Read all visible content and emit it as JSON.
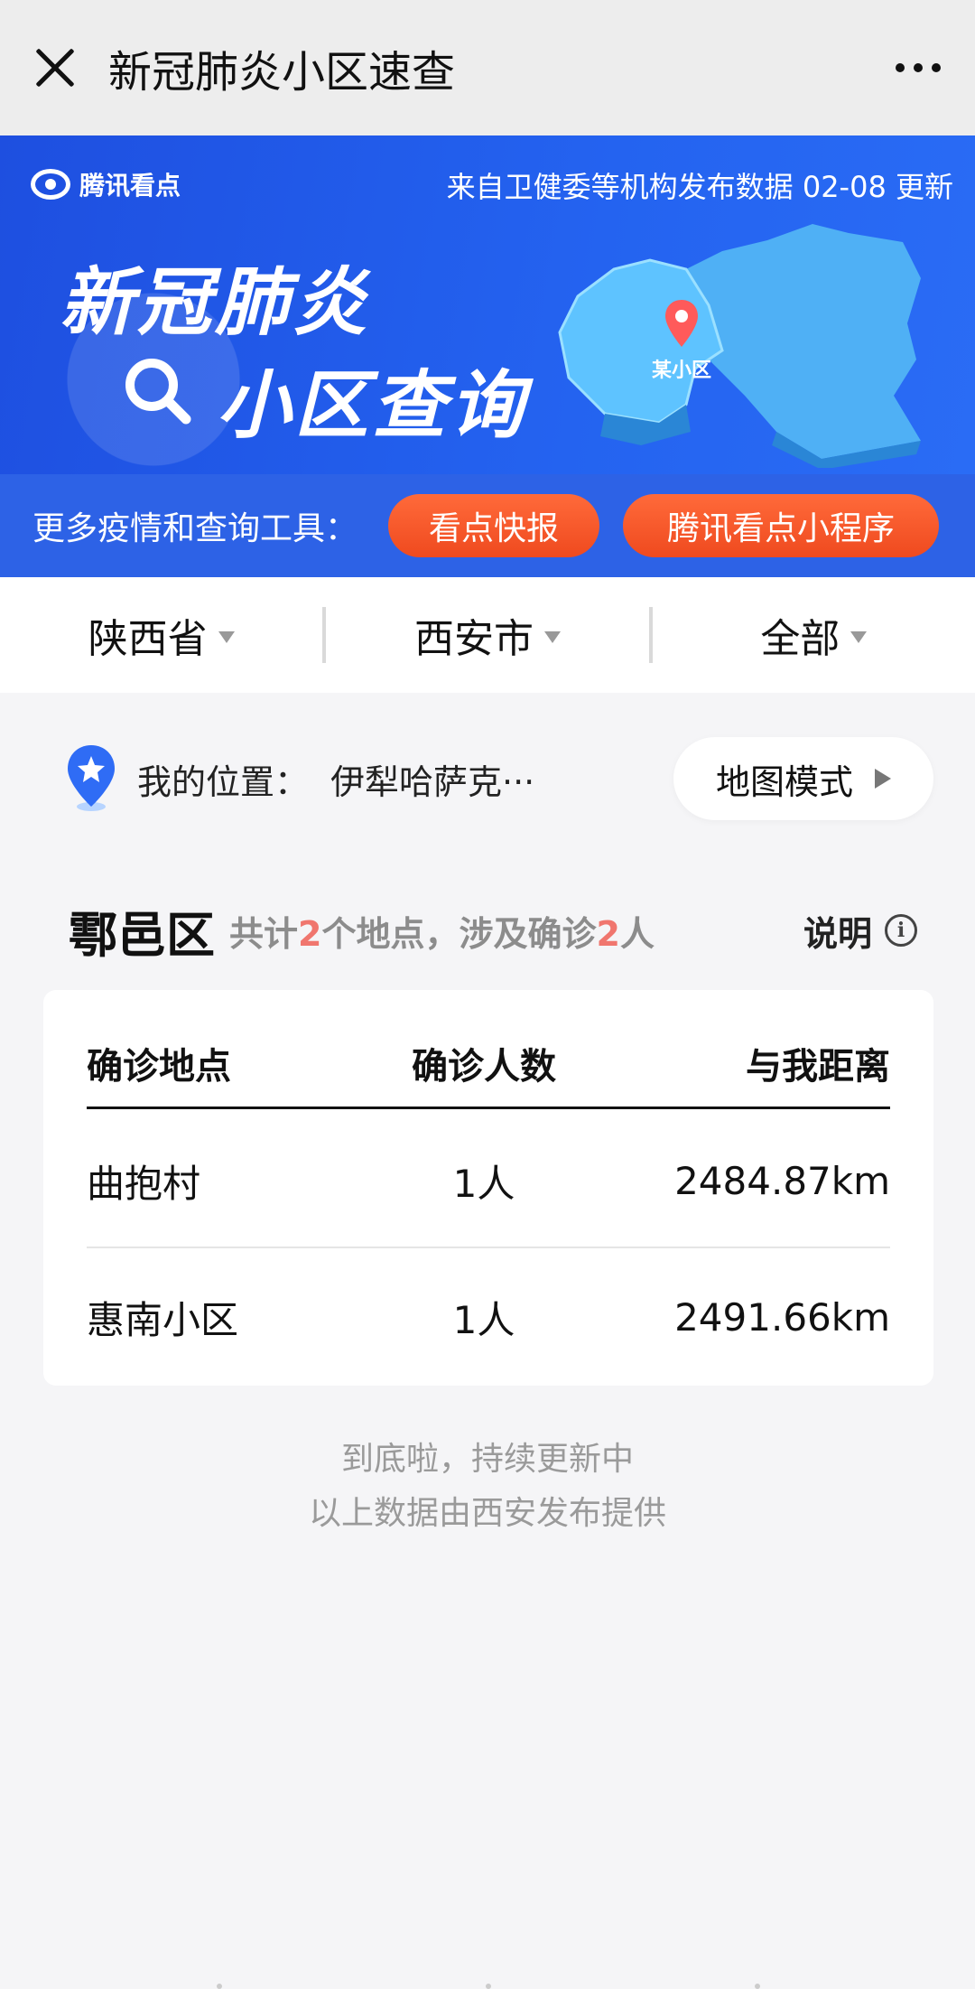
{
  "titlebar": {
    "title": "新冠肺炎小区速查"
  },
  "banner": {
    "brand": "腾讯看点",
    "update": "来自卫健委等机构发布数据  02-08 更新",
    "title_line1": "新冠肺炎",
    "title_line2": "小区查询",
    "map_label": "某小区"
  },
  "tools": {
    "label": "更多疫情和查询工具：",
    "buttons": {
      "news": "看点快报",
      "mini_program": "腾讯看点小程序"
    }
  },
  "filters": {
    "province": "陕西省",
    "city": "西安市",
    "district": "全部"
  },
  "location": {
    "label": "我的位置：",
    "value": "伊犁哈萨克···",
    "map_mode": "地图模式"
  },
  "district": {
    "name": "鄠邑区",
    "summary_prefix": "共计",
    "places_count": "2",
    "summary_mid": "个地点，涉及确诊",
    "cases_count": "2",
    "summary_suffix": "人",
    "explain": "说明"
  },
  "table": {
    "headers": {
      "place": "确诊地点",
      "count": "确诊人数",
      "distance": "与我距离"
    },
    "rows": [
      {
        "place": "曲抱村",
        "count": "1人",
        "distance": "2484.87km"
      },
      {
        "place": "惠南小区",
        "count": "1人",
        "distance": "2491.66km"
      }
    ]
  },
  "footer": {
    "line1": "到底啦，持续更新中",
    "line2": "以上数据由西安发布提供"
  },
  "colors": {
    "banner": "#2463f0",
    "pill": "#ef4a1f",
    "highlight": "#f0766e"
  }
}
